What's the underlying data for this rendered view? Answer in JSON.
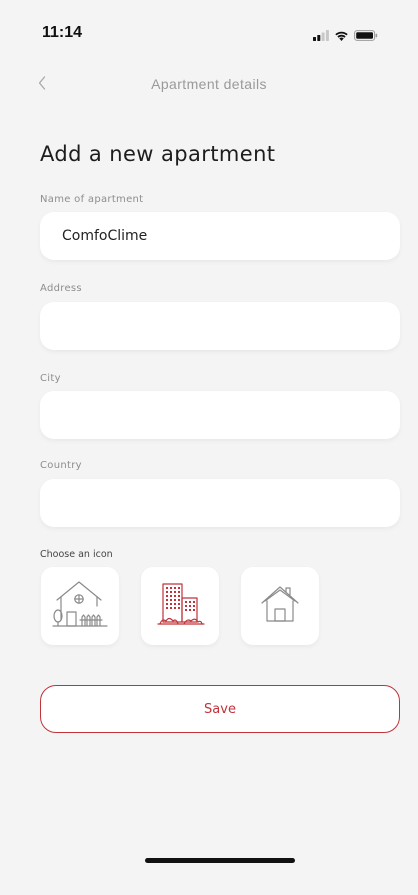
{
  "status_bar": {
    "time": "11:14",
    "icons": [
      "signal-icon",
      "wifi-icon",
      "battery-icon"
    ]
  },
  "nav": {
    "title": "Apartment details",
    "back_icon": "chevron-left-icon"
  },
  "form": {
    "heading": "Add a new apartment",
    "fields": [
      {
        "label": "Name of apartment",
        "value": "ComfoClime",
        "placeholder": ""
      },
      {
        "label": "Address",
        "value": "",
        "placeholder": ""
      },
      {
        "label": "City",
        "value": "",
        "placeholder": ""
      },
      {
        "label": "Country",
        "value": "",
        "placeholder": ""
      }
    ],
    "icon_section_label": "Choose an icon",
    "icons": [
      {
        "name": "house-with-garden-icon",
        "selected": false
      },
      {
        "name": "apartment-buildings-icon",
        "selected": true
      },
      {
        "name": "simple-house-icon",
        "selected": false
      }
    ],
    "save_label": "Save"
  },
  "colors": {
    "accent": "#c0333b",
    "background": "#f4f4f4",
    "card": "#ffffff",
    "label": "#8e8e8e",
    "icon_gray": "#8a8a8a"
  }
}
